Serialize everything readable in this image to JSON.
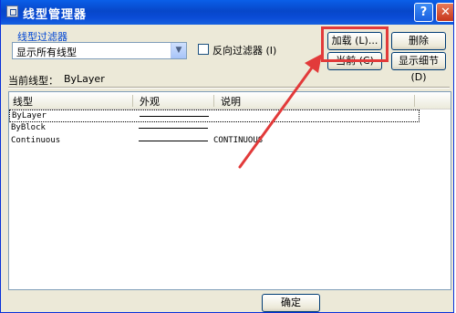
{
  "window": {
    "title": "线型管理器",
    "help_label": "?",
    "close_label": "✕"
  },
  "filter": {
    "label": "线型过滤器",
    "selected": "显示所有线型",
    "invert_label": "反向过滤器 (I)",
    "invert_checked": false
  },
  "buttons": {
    "load": "加载 (L)...",
    "delete": "删除",
    "current": "当前 (C)",
    "details": "显示细节 (D)",
    "ok": "确定"
  },
  "current": {
    "label": "当前线型：",
    "value": "ByLayer"
  },
  "table": {
    "columns": [
      "线型",
      "外观",
      "说明"
    ],
    "rows": [
      {
        "name": "ByLayer",
        "appearance": "continuous",
        "description": "",
        "selected": true
      },
      {
        "name": "ByBlock",
        "appearance": "continuous",
        "description": "",
        "selected": false
      },
      {
        "name": "Continuous",
        "appearance": "continuous",
        "description": "CONTINUOUS",
        "selected": false
      }
    ]
  },
  "annotation": {
    "highlight_color": "#e23a3a",
    "target": "load-button"
  },
  "colors": {
    "title_bar": "#0747c9",
    "dialog_bg": "#ece9d8",
    "group_label": "#0046d5"
  }
}
